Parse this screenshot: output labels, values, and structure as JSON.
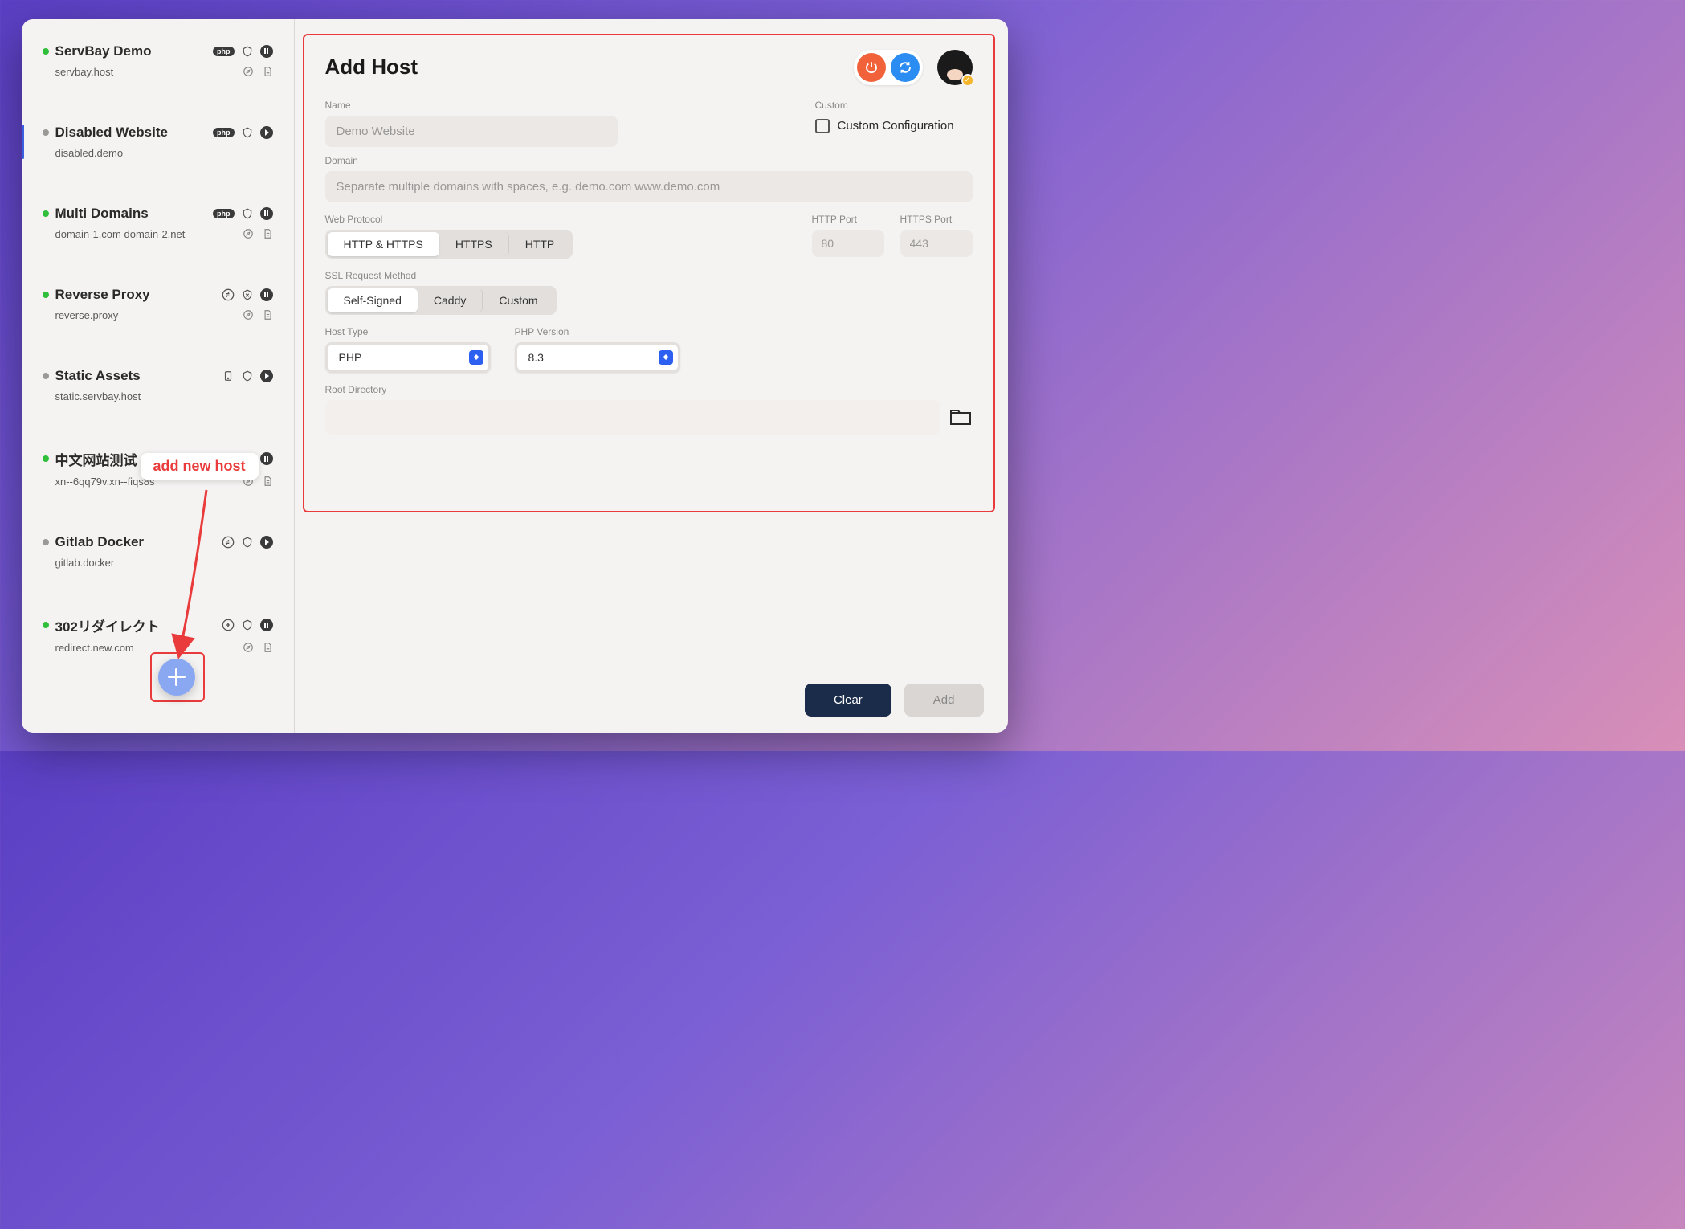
{
  "sidebar": {
    "hosts": [
      {
        "status": "green",
        "name": "ServBay Demo",
        "domain": "servbay.host",
        "badge": "php",
        "icon2": "shield",
        "action": "pause",
        "row2a": "compass",
        "row2b": "doc"
      },
      {
        "status": "gray",
        "name": "Disabled Website",
        "domain": "disabled.demo",
        "badge": "php",
        "icon2": "shield",
        "action": "play",
        "row2a": "",
        "row2b": ""
      },
      {
        "status": "green",
        "name": "Multi Domains",
        "domain": "domain-1.com domain-2.net",
        "badge": "php",
        "icon2": "shield",
        "action": "pause",
        "row2a": "compass",
        "row2b": "doc"
      },
      {
        "status": "green",
        "name": "Reverse Proxy",
        "domain": "reverse.proxy",
        "badge": "swap",
        "icon2": "shield-x",
        "action": "pause",
        "row2a": "compass",
        "row2b": "doc"
      },
      {
        "status": "gray",
        "name": "Static Assets",
        "domain": "static.servbay.host",
        "badge": "device",
        "icon2": "shield",
        "action": "play",
        "row2a": "",
        "row2b": ""
      },
      {
        "status": "green",
        "name": "中文网站测试",
        "domain": "xn--6qq79v.xn--fiqs8s",
        "badge": "php",
        "icon2": "shield",
        "action": "pause",
        "row2a": "compass",
        "row2b": "doc"
      },
      {
        "status": "gray",
        "name": "Gitlab Docker",
        "domain": "gitlab.docker",
        "badge": "swap",
        "icon2": "shield",
        "action": "play",
        "row2a": "",
        "row2b": ""
      },
      {
        "status": "green",
        "name": "302リダイレクト",
        "domain": "redirect.new.com",
        "badge": "redirect",
        "icon2": "shield",
        "action": "pause",
        "row2a": "compass",
        "row2b": "doc"
      }
    ]
  },
  "annotation": {
    "label": "add new host"
  },
  "main": {
    "title": "Add Host",
    "name_label": "Name",
    "name_placeholder": "Demo Website",
    "custom_label": "Custom",
    "custom_config_label": "Custom Configuration",
    "domain_label": "Domain",
    "domain_placeholder": "Separate multiple domains with spaces, e.g. demo.com www.demo.com",
    "protocol_label": "Web Protocol",
    "protocol_options": [
      "HTTP & HTTPS",
      "HTTPS",
      "HTTP"
    ],
    "http_port_label": "HTTP Port",
    "http_port_placeholder": "80",
    "https_port_label": "HTTPS Port",
    "https_port_placeholder": "443",
    "ssl_label": "SSL Request Method",
    "ssl_options": [
      "Self-Signed",
      "Caddy",
      "Custom"
    ],
    "hosttype_label": "Host Type",
    "hosttype_value": "PHP",
    "phpver_label": "PHP Version",
    "phpver_value": "8.3",
    "root_label": "Root Directory"
  },
  "footer": {
    "clear": "Clear",
    "add": "Add"
  }
}
